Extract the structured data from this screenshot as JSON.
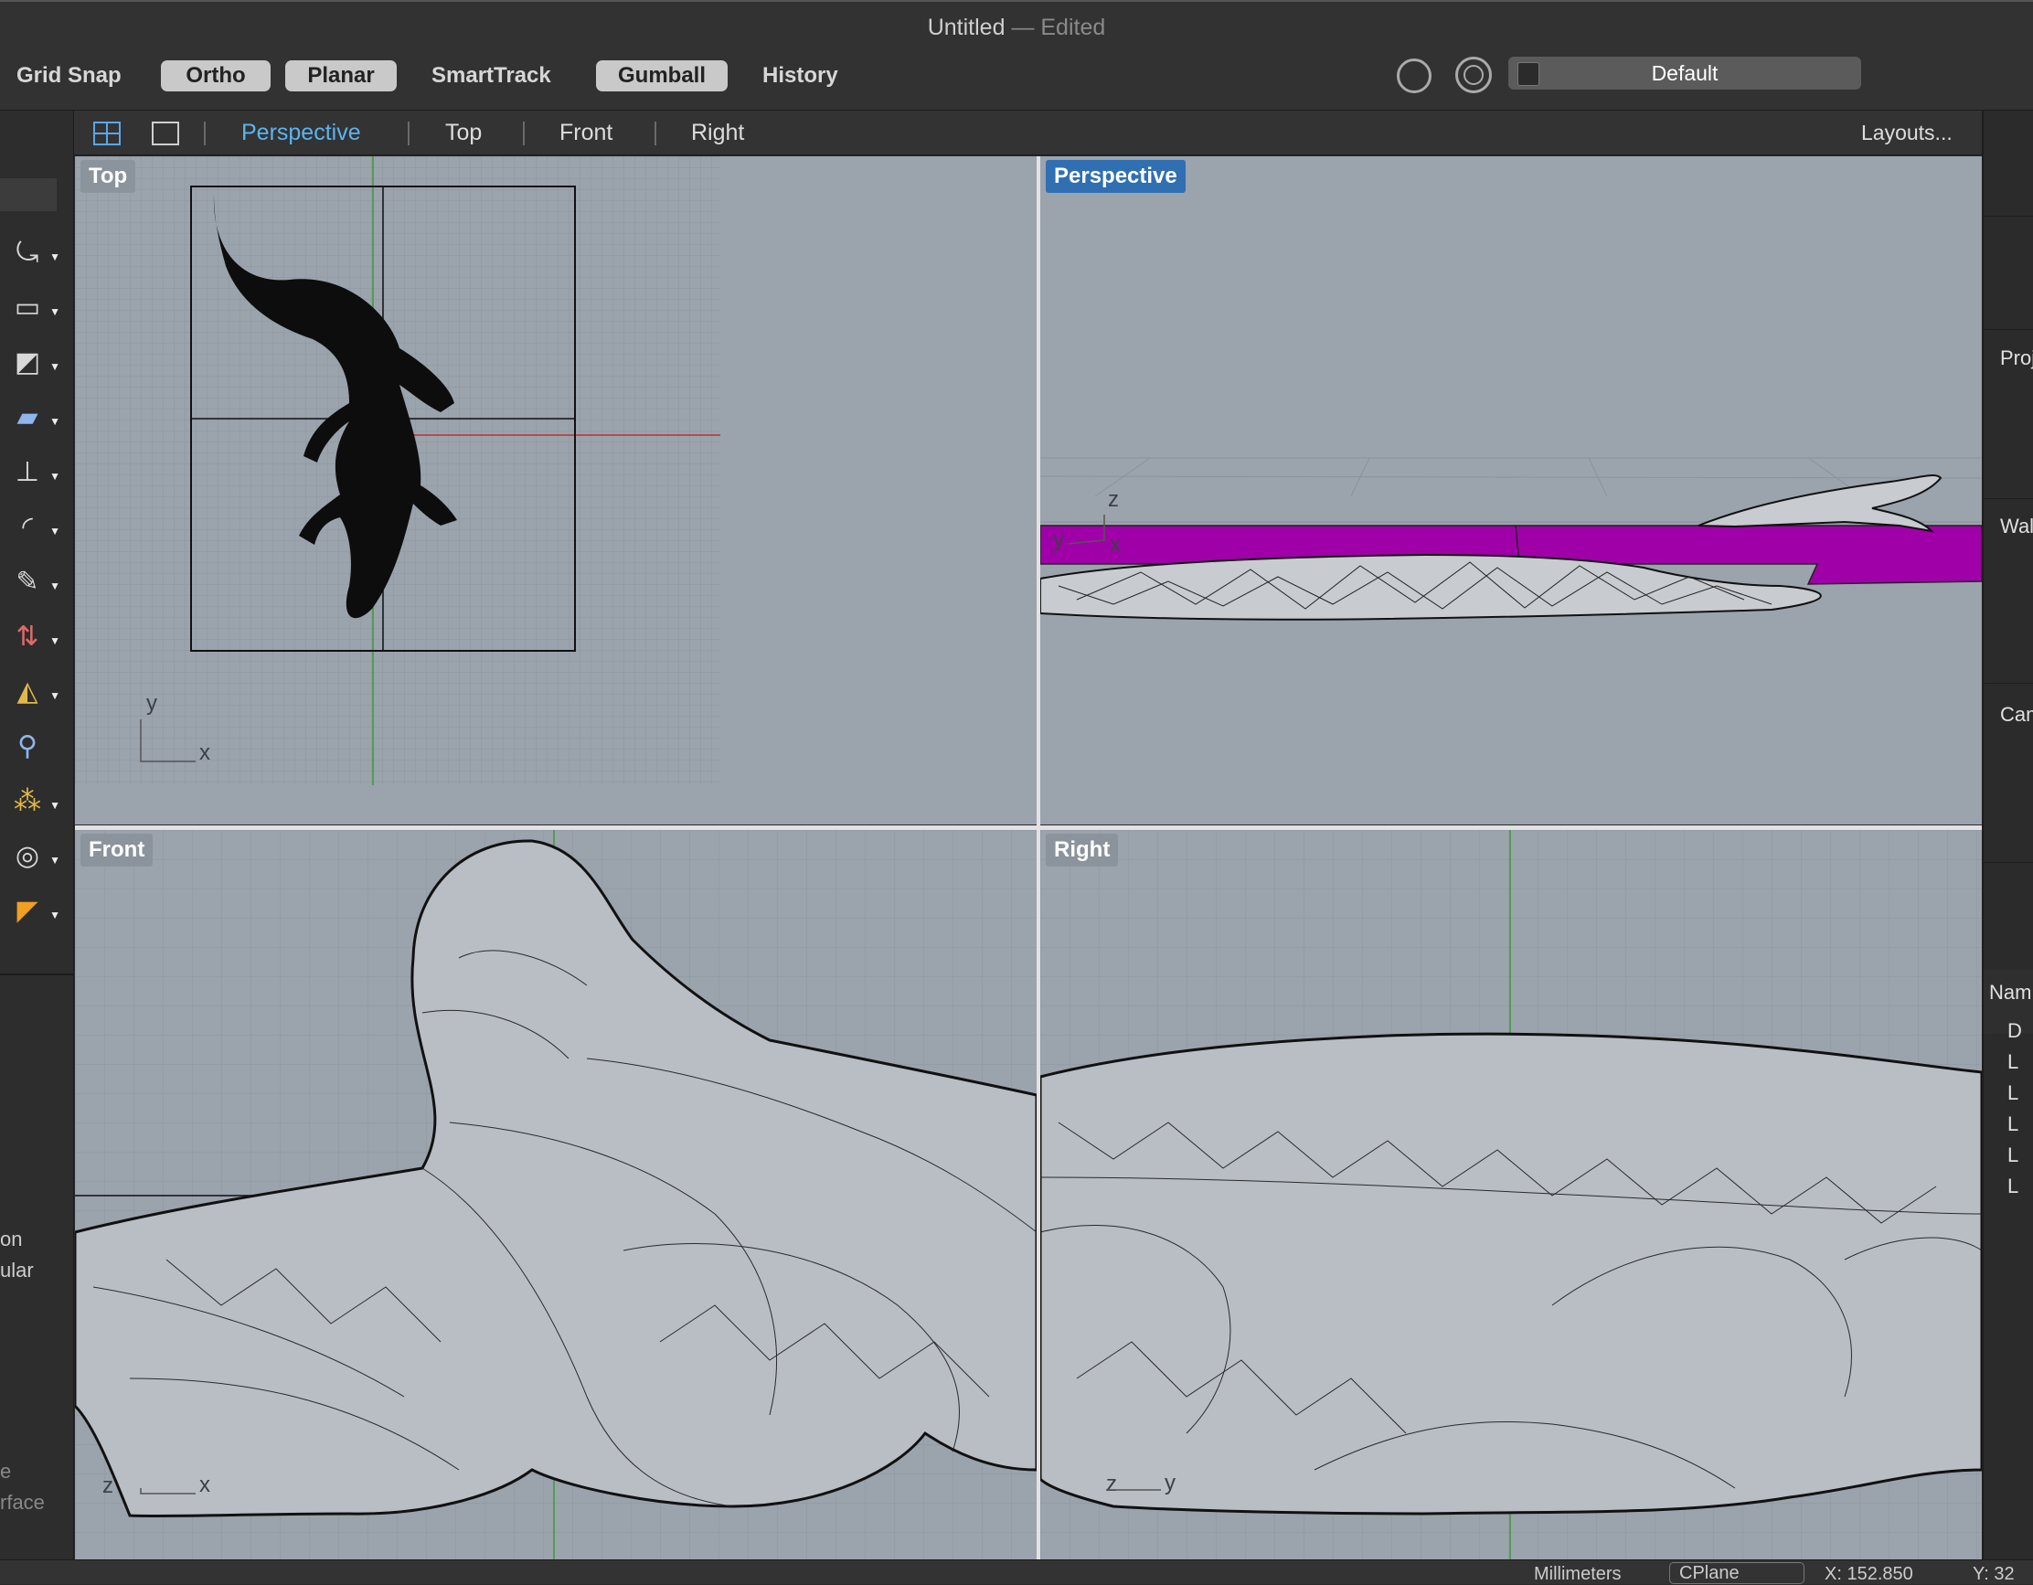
{
  "window": {
    "title": "Untitled",
    "title_suffix": "— Edited"
  },
  "toolbar": {
    "grid_snap": "Grid Snap",
    "ortho": "Ortho",
    "planar": "Planar",
    "smarttrack": "SmartTrack",
    "gumball": "Gumball",
    "history": "History",
    "layer": "Default"
  },
  "viewport_tabs": {
    "perspective": "Perspective",
    "top": "Top",
    "front": "Front",
    "right": "Right",
    "layouts": "Layouts..."
  },
  "viewports": {
    "top": {
      "label": "Top",
      "axis_x": "x",
      "axis_y": "y"
    },
    "perspective": {
      "label": "Perspective",
      "axis_x": "x",
      "axis_y": "y",
      "axis_z": "z"
    },
    "front": {
      "label": "Front",
      "axis_x": "x",
      "axis_z": "z"
    },
    "right": {
      "label": "Right",
      "axis_y": "y",
      "axis_z": "z"
    }
  },
  "left_panel": {
    "text1": "on",
    "text2": "ular",
    "text3": "e",
    "text4": "rface"
  },
  "right_panel": {
    "proj": "Proj",
    "wal": "Wal",
    "cam": "Cam",
    "nam": "Nam",
    "rows": [
      "D",
      "L",
      "L",
      "L",
      "L",
      "L"
    ]
  },
  "status": {
    "units": "Millimeters",
    "cplane": "CPlane",
    "x": "X: 152.850",
    "y": "Y: 32"
  },
  "colors": {
    "accent": "#2f6fb2",
    "magenta": "#a000a8",
    "viewport_bg": "#9ba3ad"
  }
}
